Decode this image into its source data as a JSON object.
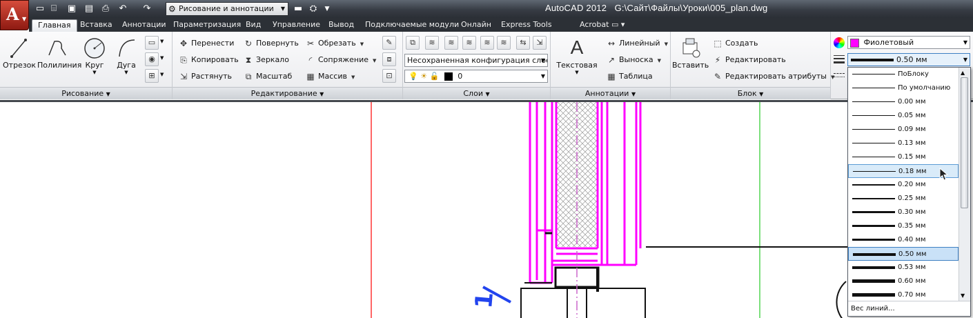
{
  "title": {
    "app": "AutoCAD 2012",
    "file": "G:\\Сайт\\Файлы\\Уроки\\005_plan.dwg"
  },
  "workspace": "Рисование и аннотации",
  "tabs": [
    "Главная",
    "Вставка",
    "Аннотации",
    "Параметризация",
    "Вид",
    "Управление",
    "Вывод",
    "Подключаемые модули",
    "Онлайн",
    "Express Tools",
    "Acrobat"
  ],
  "draw_panel": {
    "title": "Рисование",
    "tools": [
      "Отрезок",
      "Полилиния",
      "Круг",
      "Дуга"
    ]
  },
  "modify_panel": {
    "title": "Редактирование",
    "col1": [
      "Перенести",
      "Копировать",
      "Растянуть"
    ],
    "col2": [
      "Повернуть",
      "Зеркало",
      "Масштаб"
    ],
    "col3": [
      "Обрезать",
      "Сопряжение",
      "Массив"
    ]
  },
  "layers_panel": {
    "title": "Слои",
    "state": "Несохраненная конфигурация слоев",
    "current_layer": "0"
  },
  "annot_panel": {
    "title": "Аннотации",
    "text": "Текстовая",
    "items": [
      "Линейный",
      "Выноска",
      "Таблица"
    ]
  },
  "block_panel": {
    "title": "Блок",
    "insert": "Вставить",
    "items": [
      "Создать",
      "Редактировать",
      "Редактировать атрибуты"
    ]
  },
  "props": {
    "color": "Фиолетовый",
    "lineweight": "0.50 мм"
  },
  "lineweight_list": {
    "items": [
      {
        "label": "ПоБлоку",
        "w": 1
      },
      {
        "label": "По умолчанию",
        "w": 1
      },
      {
        "label": "0.00 мм",
        "w": 1
      },
      {
        "label": "0.05 мм",
        "w": 1
      },
      {
        "label": "0.09 мм",
        "w": 1
      },
      {
        "label": "0.13 мм",
        "w": 1
      },
      {
        "label": "0.15 мм",
        "w": 1
      },
      {
        "label": "0.18 мм",
        "w": 1
      },
      {
        "label": "0.20 мм",
        "w": 2
      },
      {
        "label": "0.25 мм",
        "w": 2
      },
      {
        "label": "0.30 мм",
        "w": 3
      },
      {
        "label": "0.35 мм",
        "w": 3
      },
      {
        "label": "0.40 мм",
        "w": 3
      },
      {
        "label": "0.50 мм",
        "w": 4
      },
      {
        "label": "0.53 мм",
        "w": 4
      },
      {
        "label": "0.60 мм",
        "w": 5
      },
      {
        "label": "0.70 мм",
        "w": 5
      }
    ],
    "hover_index": 7,
    "selected_index": 13,
    "footer": "Вес линий..."
  },
  "canvas": {
    "annotation": "1",
    "accent": "#ff00ff"
  }
}
